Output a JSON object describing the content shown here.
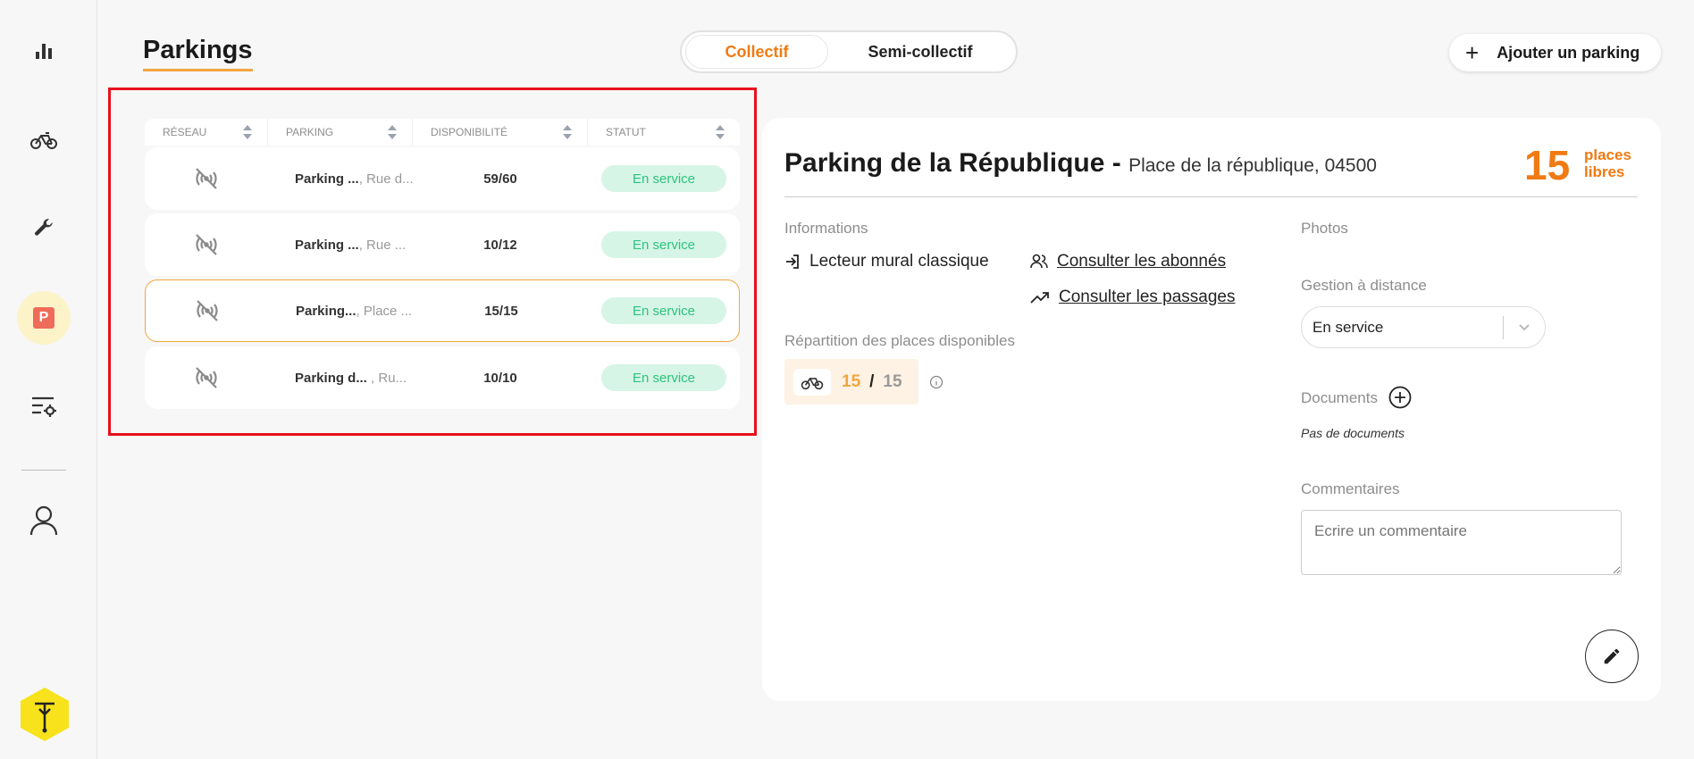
{
  "page": {
    "title": "Parkings"
  },
  "mode_toggle": {
    "active": "Collectif",
    "inactive": "Semi-collectif"
  },
  "add_button": {
    "label": "Ajouter un parking"
  },
  "table": {
    "columns": [
      "Réseau",
      "Parking",
      "Disponibilité",
      "Statut"
    ],
    "rows": [
      {
        "name": "Parking ...",
        "address": ", Rue d...",
        "availability": "59/60",
        "status": "En service"
      },
      {
        "name": "Parking ...",
        "address": ", Rue ...",
        "availability": "10/12",
        "status": "En service"
      },
      {
        "name": "Parking...",
        "address": ", Place ...",
        "availability": "15/15",
        "status": "En service"
      },
      {
        "name": "Parking d...",
        "address": " , Ru...",
        "availability": "10/10",
        "status": "En service"
      }
    ]
  },
  "detail": {
    "title": "Parking de la République -",
    "address": "Place de la république, 04500",
    "free_count": "15",
    "free_label_line1": "places",
    "free_label_line2": "libres",
    "informations_label": "Informations",
    "reader_type": "Lecteur mural classique",
    "link_subscribers": "Consulter les abonnés",
    "link_passages": "Consulter les passages",
    "distribution_label": "Répartition des places disponibles",
    "distribution_available": "15",
    "distribution_separator": "/",
    "distribution_total": "15",
    "photos_label": "Photos",
    "remote_label": "Gestion à distance",
    "remote_value": "En service",
    "documents_label": "Documents",
    "no_documents": "Pas de documents",
    "comments_label": "Commentaires",
    "comment_placeholder": "Ecrire un commentaire"
  },
  "colors": {
    "accent": "#f07a13",
    "accent_soft": "#f2a541",
    "status_bg": "#d6f5e6",
    "status_fg": "#2ec27e",
    "frame": "#e8101c"
  }
}
